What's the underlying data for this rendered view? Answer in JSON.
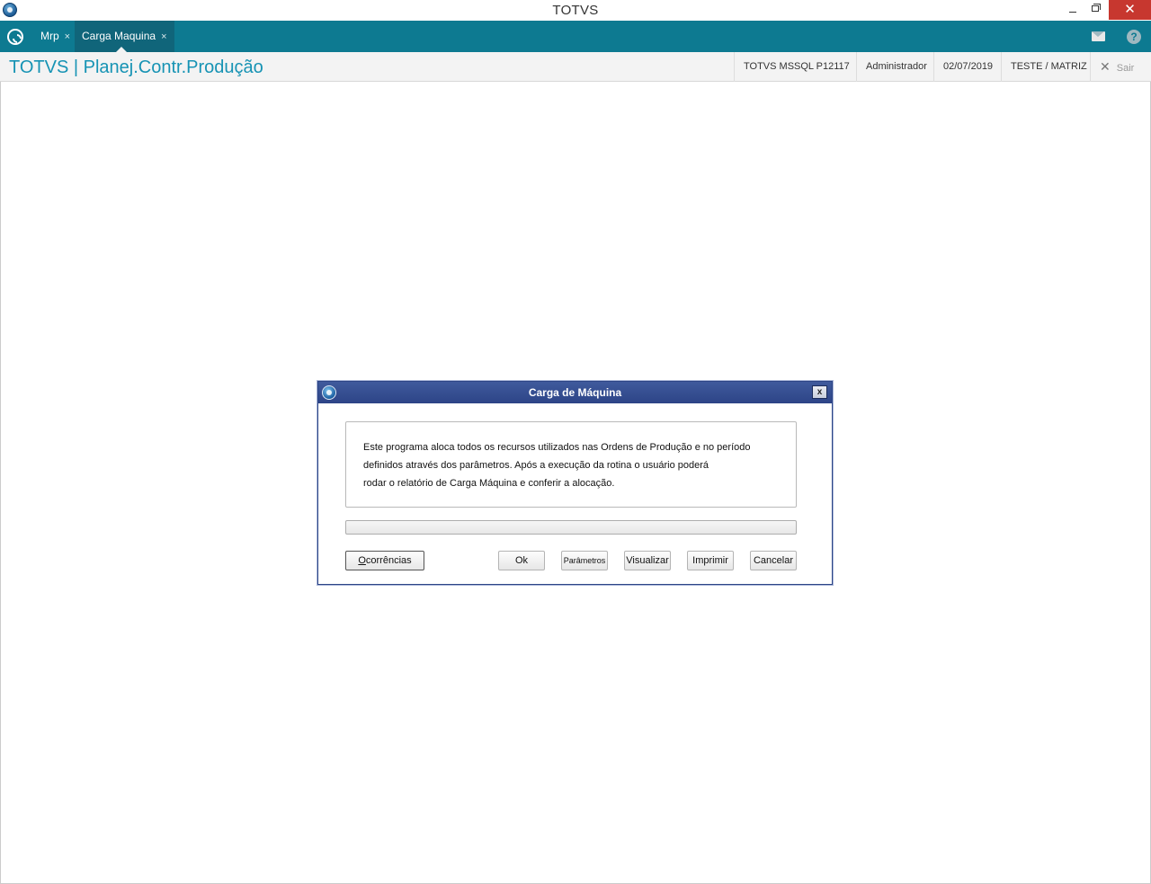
{
  "window": {
    "title": "TOTVS",
    "minimize_label": "",
    "close_label": "✕"
  },
  "tabs": [
    {
      "label": "Mrp",
      "close": "×"
    },
    {
      "label": "Carga Maquina",
      "close": "×"
    }
  ],
  "header": {
    "title": "TOTVS | Planej.Contr.Produção",
    "environment": "TOTVS  MSSQL P12117",
    "user": "Administrador",
    "date": "02/07/2019",
    "branch": "TESTE / MATRIZ",
    "exit_label": "Sair"
  },
  "dialog": {
    "title": "Carga de Máquina",
    "close_label": "x",
    "message_lines": [
      "Este programa aloca todos os recursos utilizados nas Ordens de Produção e no período",
      "definidos através dos parâmetros. Após a execução da rotina o usuário poderá",
      "rodar o relatório de Carga Máquina e conferir a alocação."
    ],
    "progress": 0,
    "buttons": {
      "ocorrencias_first": "O",
      "ocorrencias_rest": "corrências",
      "ok": "Ok",
      "parametros": "Parâmetros",
      "visualizar": "Visualizar",
      "imprimir": "Imprimir",
      "cancelar": "Cancelar"
    }
  },
  "colors": {
    "tabbar": "#0d7a91",
    "header_title": "#1693b4",
    "dialog_titlebar": "#2d4487",
    "window_close": "#c7372f"
  },
  "icons": [
    "totvs-app-icon",
    "home-icon",
    "mail-icon",
    "help-icon",
    "close-icon"
  ]
}
